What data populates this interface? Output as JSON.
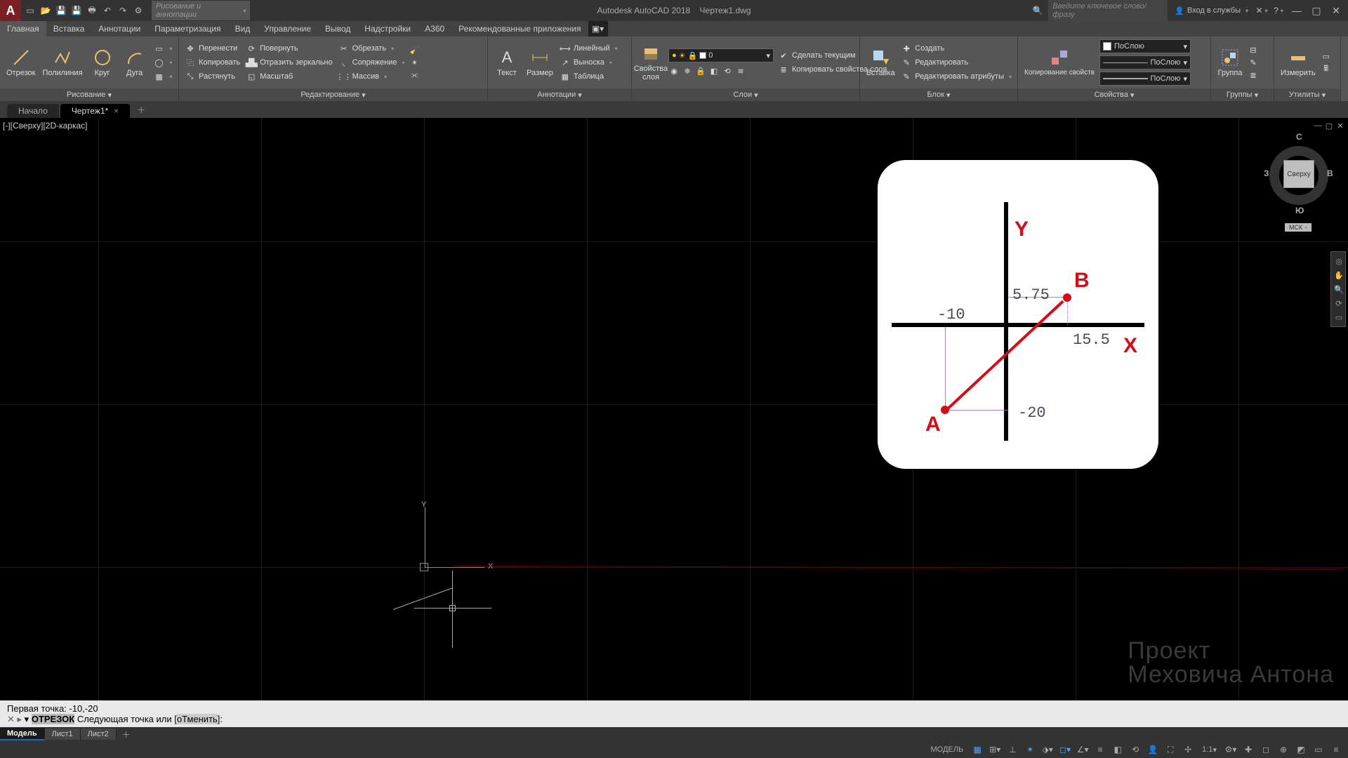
{
  "title": {
    "app": "Autodesk AutoCAD 2018",
    "doc": "Чертеж1.dwg"
  },
  "qat_workspace": "Рисование и аннотации",
  "search_placeholder": "Введите ключевое слово/фразу",
  "signin": "Вход в службы",
  "menu": [
    "Главная",
    "Вставка",
    "Аннотации",
    "Параметризация",
    "Вид",
    "Управление",
    "Вывод",
    "Надстройки",
    "A360",
    "Рекомендованные приложения"
  ],
  "ribbon": {
    "draw": {
      "title": "Рисование",
      "line": "Отрезок",
      "pline": "Полилиния",
      "circle": "Круг",
      "arc": "Дуга"
    },
    "modify": {
      "title": "Редактирование",
      "move": "Перенести",
      "rotate": "Повернуть",
      "trim": "Обрезать",
      "copy": "Копировать",
      "mirror": "Отразить зеркально",
      "fillet": "Сопряжение",
      "stretch": "Растянуть",
      "scale": "Масштаб",
      "array": "Массив"
    },
    "annot": {
      "title": "Аннотации",
      "text": "Текст",
      "dim": "Размер",
      "linear": "Линейный",
      "leader": "Выноска",
      "table": "Таблица"
    },
    "layers": {
      "title": "Слои",
      "props": "Свойства слоя",
      "makecur": "Сделать текущим",
      "match": "Копировать свойства слоя",
      "value": "0"
    },
    "block": {
      "title": "Блок",
      "insert": "Вставка",
      "create": "Создать",
      "edit": "Редактировать",
      "editattr": "Редактировать атрибуты"
    },
    "props": {
      "title": "Свойства",
      "match": "Копирование свойств",
      "bylayer": "ПоСлою"
    },
    "groups": {
      "title": "Группы",
      "group": "Группа"
    },
    "utils": {
      "title": "Утилиты",
      "measure": "Измерить"
    }
  },
  "filetabs": {
    "start": "Начало",
    "doc": "Чертеж1*"
  },
  "viewport_label": "[-][Сверху][2D-каркас]",
  "viewcube": {
    "top": "Сверху",
    "n": "С",
    "e": "В",
    "s": "Ю",
    "w": "З",
    "wcs": "МСК"
  },
  "overlay": {
    "y_label": "Y",
    "x_label": "X",
    "a_label": "A",
    "b_label": "B",
    "v_575": "5.75",
    "v_n10": "-10",
    "v_155": "15.5",
    "v_n20": "-20"
  },
  "watermark": {
    "l1": "Проект",
    "l2": "Меховича Антона"
  },
  "cmd": {
    "prev": "Первая точка: -10,-20",
    "cmd_name": "ОТРЕЗОК",
    "rest": " Следующая точка или [",
    "opt": "оТменить",
    "end": "]:"
  },
  "layouts": {
    "model": "Модель",
    "l1": "Лист1",
    "l2": "Лист2"
  },
  "status": {
    "model": "МОДЕЛЬ",
    "scale": "1:1"
  }
}
